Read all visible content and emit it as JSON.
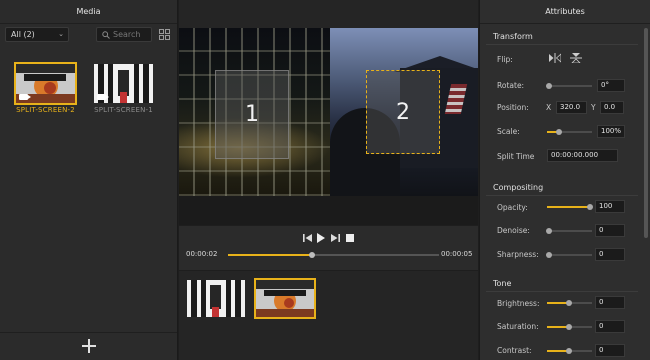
{
  "media": {
    "title": "Media",
    "filter": "All (2)",
    "search_placeholder": "Search",
    "clips": [
      {
        "name": "SPLIT-SCREEN-2",
        "selected": true
      },
      {
        "name": "SPLIT-SCREEN-1",
        "selected": false
      }
    ]
  },
  "preview": {
    "zones": [
      "1",
      "2"
    ],
    "current_time": "00:00:02",
    "total_time": "00:00:05",
    "progress": 0.4
  },
  "attributes": {
    "title": "Attributes",
    "transform": {
      "title": "Transform",
      "flip_label": "Flip:",
      "rotate_label": "Rotate:",
      "rotate_value": "0°",
      "position_label": "Position:",
      "x_label": "X",
      "x_value": "320.0",
      "y_label": "Y",
      "y_value": "0.0",
      "scale_label": "Scale:",
      "scale_value": "100%",
      "split_time_label": "Split Time",
      "split_time_value": "00:00:00.000"
    },
    "compositing": {
      "title": "Compositing",
      "opacity_label": "Opacity:",
      "opacity_value": "100",
      "denoise_label": "Denoise:",
      "denoise_value": "0",
      "sharpness_label": "Sharpness:",
      "sharpness_value": "0"
    },
    "tone": {
      "title": "Tone",
      "brightness_label": "Brightness:",
      "brightness_value": "0",
      "saturation_label": "Saturation:",
      "saturation_value": "0",
      "contrast_label": "Contrast:",
      "contrast_value": "0"
    }
  },
  "colors": {
    "accent": "#e8b21a",
    "panel": "#2b2b2b",
    "background": "#1e1e1e"
  }
}
